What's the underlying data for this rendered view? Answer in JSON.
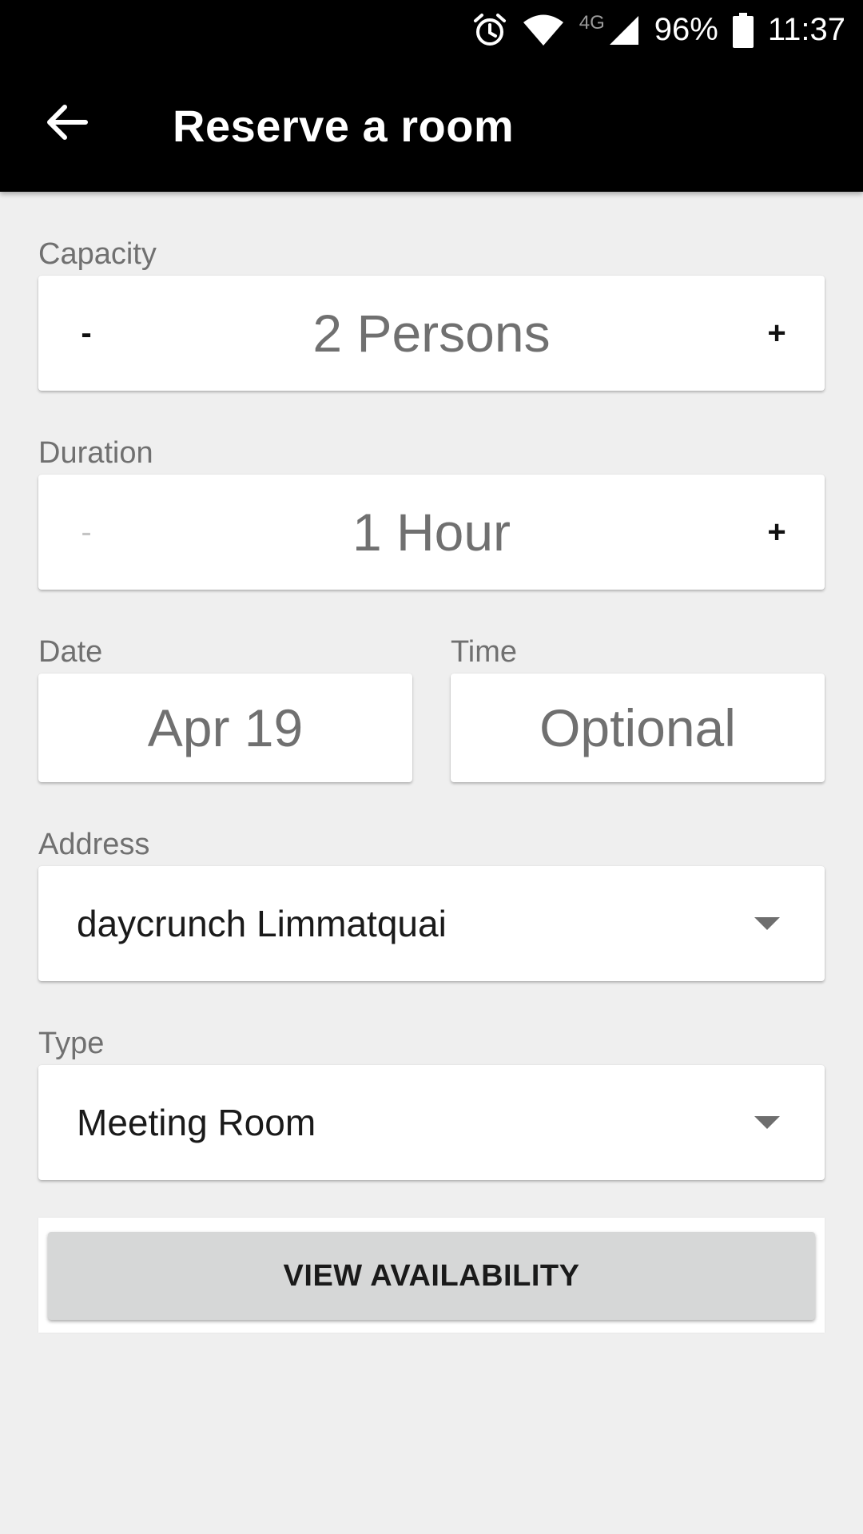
{
  "status_bar": {
    "network": "4G",
    "battery": "96%",
    "time": "11:37",
    "icons": [
      "alarm-icon",
      "wifi-icon",
      "cell-signal-icon",
      "battery-icon"
    ]
  },
  "app_bar": {
    "title": "Reserve a room",
    "back_icon": "arrow-left-icon"
  },
  "form": {
    "capacity": {
      "label": "Capacity",
      "minus": "-",
      "value": "2 Persons",
      "plus": "+"
    },
    "duration": {
      "label": "Duration",
      "minus": "-",
      "value": "1 Hour",
      "plus": "+",
      "minus_disabled": true
    },
    "date": {
      "label": "Date",
      "value": "Apr 19"
    },
    "time": {
      "label": "Time",
      "value": "Optional"
    },
    "address": {
      "label": "Address",
      "value": "daycrunch Limmatquai"
    },
    "type": {
      "label": "Type",
      "value": "Meeting Room"
    }
  },
  "actions": {
    "view_availability": "VIEW AVAILABILITY"
  },
  "colors": {
    "app_bar": "#000000",
    "background": "#efefef",
    "card": "#ffffff",
    "label": "#707070",
    "button": "#d6d7d7"
  }
}
